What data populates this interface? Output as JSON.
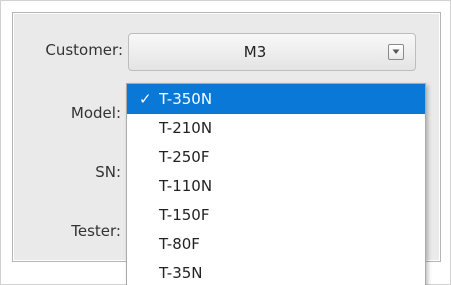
{
  "form": {
    "customer_label": "Customer:",
    "model_label": "Model:",
    "sn_label": "SN:",
    "tester_label": "Tester:",
    "customer_value": "M3"
  },
  "dropdown": {
    "selected_index": 0,
    "check_mark": "✓",
    "items": [
      "T-350N",
      "T-210N",
      "T-250F",
      "T-110N",
      "T-150F",
      "T-80F",
      "T-35N"
    ]
  },
  "icons": {
    "combo_arrow": "chevron-down-icon",
    "check": "check-icon"
  },
  "colors": {
    "selection": "#0a78d7",
    "panel": "#eaeaea"
  }
}
